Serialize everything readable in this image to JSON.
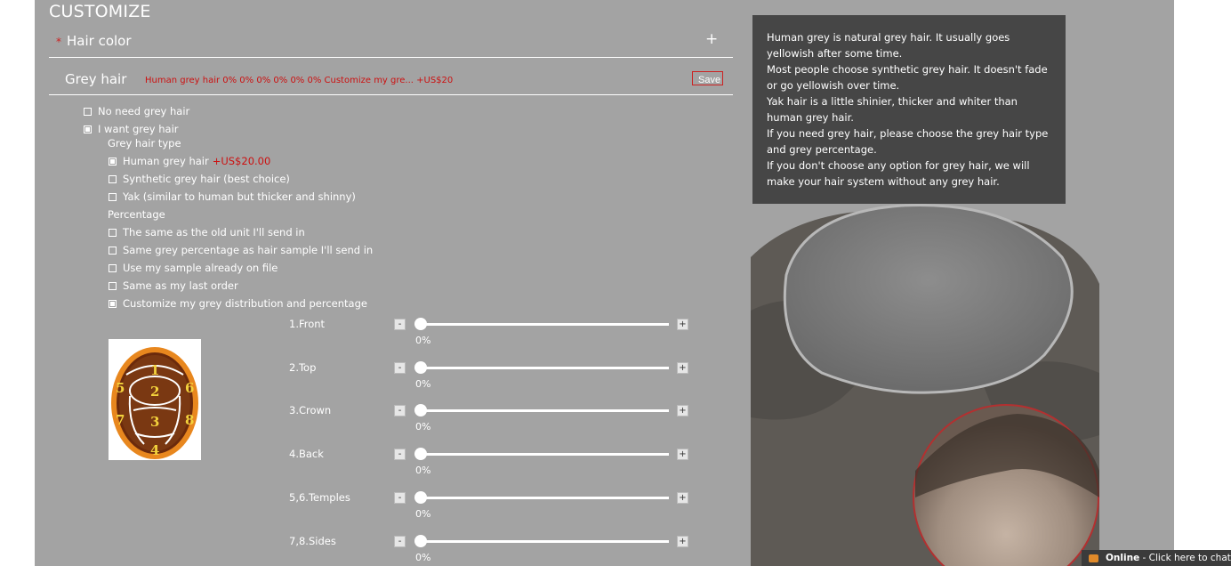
{
  "page": {
    "title": "CUSTOMIZE"
  },
  "hair_color": {
    "required_mark": "*",
    "label": "Hair color",
    "expand": "+"
  },
  "grey_hair": {
    "label": "Grey hair",
    "summary": "Human grey hair 0% 0% 0% 0% 0% 0% Customize my gre... +US$20",
    "save_label": "Save",
    "options": [
      {
        "label": "No need grey hair",
        "checked": false
      },
      {
        "label": "I want grey hair",
        "checked": true
      }
    ],
    "type_heading": "Grey hair type",
    "types": [
      {
        "label": "Human grey hair",
        "price": "+US$20.00",
        "checked": true
      },
      {
        "label": "Synthetic grey hair (best choice)",
        "checked": false
      },
      {
        "label": "Yak (similar to human but thicker and shinny)",
        "checked": false
      }
    ],
    "percentage_heading": "Percentage",
    "percentages": [
      {
        "label": "The same as the old unit I'll send in",
        "checked": false
      },
      {
        "label": "Same grey percentage as hair sample I'll send in",
        "checked": false
      },
      {
        "label": "Use my sample already on file",
        "checked": false
      },
      {
        "label": "Same as my last order",
        "checked": false
      },
      {
        "label": "Customize my grey distribution and percentage",
        "checked": true
      }
    ],
    "sliders": [
      {
        "label": "1.Front",
        "value": "0%",
        "fraction": 0
      },
      {
        "label": "2.Top",
        "value": "0%",
        "fraction": 0
      },
      {
        "label": "3.Crown",
        "value": "0%",
        "fraction": 0
      },
      {
        "label": "4.Back",
        "value": "0%",
        "fraction": 0
      },
      {
        "label": "5,6.Temples",
        "value": "0%",
        "fraction": 0
      },
      {
        "label": "7,8.Sides",
        "value": "0%",
        "fraction": 0
      }
    ],
    "minus": "-",
    "plus": "+",
    "diagram_numbers": [
      "1",
      "2",
      "3",
      "4",
      "5",
      "6",
      "7",
      "8"
    ]
  },
  "info_box": {
    "lines": [
      "Human grey is natural grey hair. It usually goes yellowish after some time.",
      "Most people choose synthetic grey hair. It doesn't fade or go yellowish over time.",
      "Yak hair is a little shinier, thicker and whiter than human grey hair.",
      "If you need grey hair, please choose the grey hair type and grey percentage.",
      "If you don't choose any option for grey hair, we will make your hair system without any grey hair."
    ]
  },
  "chat": {
    "status": "Online",
    "text": " - Click here to chat"
  },
  "colors": {
    "panel": "#a3a3a3",
    "accent_red": "#cc1111",
    "info_bg": "#464646"
  }
}
